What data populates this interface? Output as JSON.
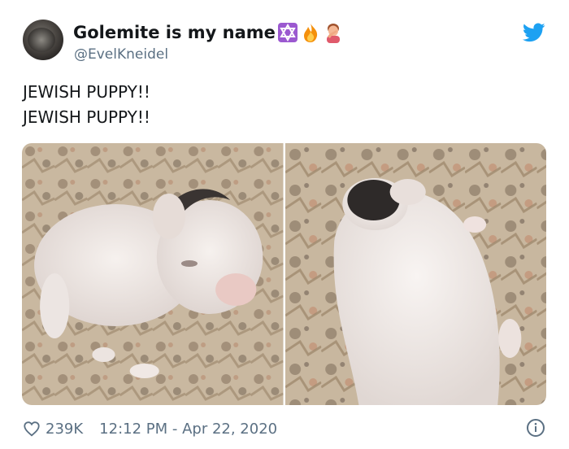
{
  "tweet": {
    "display_name": "Golemite is my name",
    "name_emojis": [
      "star-of-david-emoji",
      "fire-emoji",
      "person-facepalming-emoji"
    ],
    "handle": "@EvelKneidel",
    "text_lines": [
      "JEWISH PUPPY!!",
      "JEWISH PUPPY!!"
    ],
    "media": [
      {
        "icon": "puppy-photo-sitting"
      },
      {
        "icon": "puppy-photo-lying"
      }
    ],
    "likes": "239K",
    "timestamp": "12:12 PM - Apr 22, 2020"
  },
  "colors": {
    "twitter_blue": "#1da1f2",
    "secondary_text": "#5b7083",
    "primary_text": "#14171a",
    "star_tile": "#9b59d0"
  },
  "icons": {
    "brand": "twitter-bird-icon",
    "like": "heart-icon",
    "info": "info-icon"
  }
}
